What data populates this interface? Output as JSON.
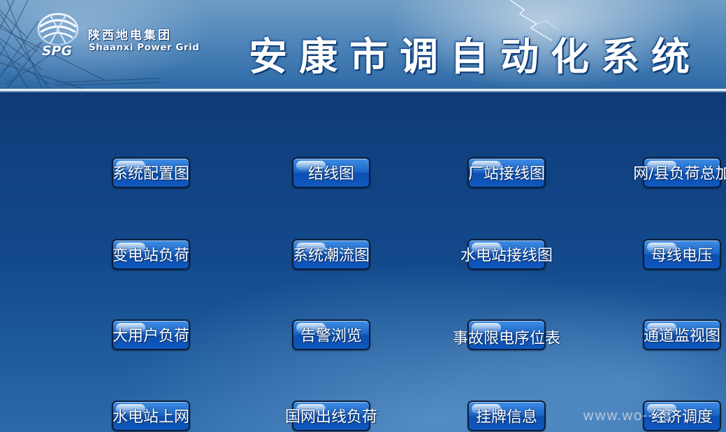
{
  "header": {
    "logo_abbr": "SPG",
    "logo_name_cn": "陕西地电集团",
    "logo_name_en": "Shaanxi Power Grid",
    "title": "安康市调自动化系统"
  },
  "nav": {
    "row1": [
      "系统配置图",
      "结线图",
      "厂站接线图",
      "网/县负荷总加"
    ],
    "row2": [
      "变电站负荷",
      "系统潮流图",
      "水电站接线图",
      "母线电压"
    ],
    "row3": [
      "大用户负荷",
      "告警浏览",
      "事故限电序位表",
      "通道监视图"
    ],
    "row4": [
      "水电站上网",
      "国网出线负荷",
      "挂牌信息",
      "经济调度"
    ]
  },
  "watermark": "www.wo---度",
  "colors": {
    "body_bg": "#134a8c",
    "button_face": "#1c66c6",
    "button_border": "#0a1e3a",
    "banner_bg": "#4f86b9"
  }
}
